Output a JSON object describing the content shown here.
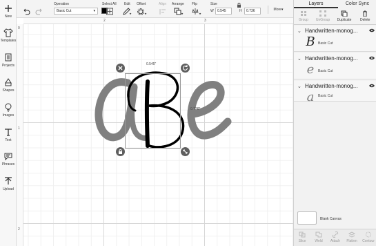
{
  "left_toolbar": {
    "items": [
      {
        "label": "New",
        "icon": "plus-icon"
      },
      {
        "label": "Templates",
        "icon": "shirt-icon"
      },
      {
        "label": "Projects",
        "icon": "projects-icon"
      },
      {
        "label": "Shapes",
        "icon": "shapes-icon"
      },
      {
        "label": "Images",
        "icon": "lightbulb-icon"
      },
      {
        "label": "Text",
        "icon": "text-icon"
      },
      {
        "label": "Phrases",
        "icon": "speech-bubble-icon"
      },
      {
        "label": "Upload",
        "icon": "upload-icon"
      }
    ]
  },
  "topbar": {
    "operation_label": "Operation",
    "operation_value": "Basic Cut",
    "select_all_label": "Select All",
    "edit_label": "Edit",
    "offset_label": "Offset",
    "align_label": "Align",
    "arrange_label": "Arrange",
    "flip_label": "Flip",
    "size_label": "Size",
    "width_letter": "W",
    "width_value": "0.545",
    "height_letter": "H",
    "height_value": "0.736",
    "more_label": "More▾",
    "swatch_color": "#000000"
  },
  "ruler": {
    "top_numbers": [
      "2",
      "3"
    ],
    "left_numbers": [
      "0",
      "1",
      "2"
    ]
  },
  "canvas": {
    "width_dim": "0.545\"",
    "height_dim": "0.736\"",
    "letters": [
      "a",
      "B",
      "e"
    ],
    "grey_letter_color": "#808080",
    "black_letter_color": "#000000"
  },
  "right_panel": {
    "tabs": [
      "Layers",
      "Color Sync"
    ],
    "tools": [
      "Group",
      "UnGroup",
      "Duplicate",
      "Delete"
    ],
    "layers": [
      {
        "name": "Handwritten-monog...",
        "glyph": "B",
        "operation": "Basic Cut"
      },
      {
        "name": "Handwritten-monog...",
        "glyph": "e",
        "operation": "Basic Cut"
      },
      {
        "name": "Handwritten-monog...",
        "glyph": "a",
        "operation": "Basic Cut"
      }
    ],
    "blank_canvas_label": "Blank Canvas",
    "bottom_tools": [
      "Slice",
      "Weld",
      "Attach",
      "Flatten",
      "Contour"
    ]
  }
}
